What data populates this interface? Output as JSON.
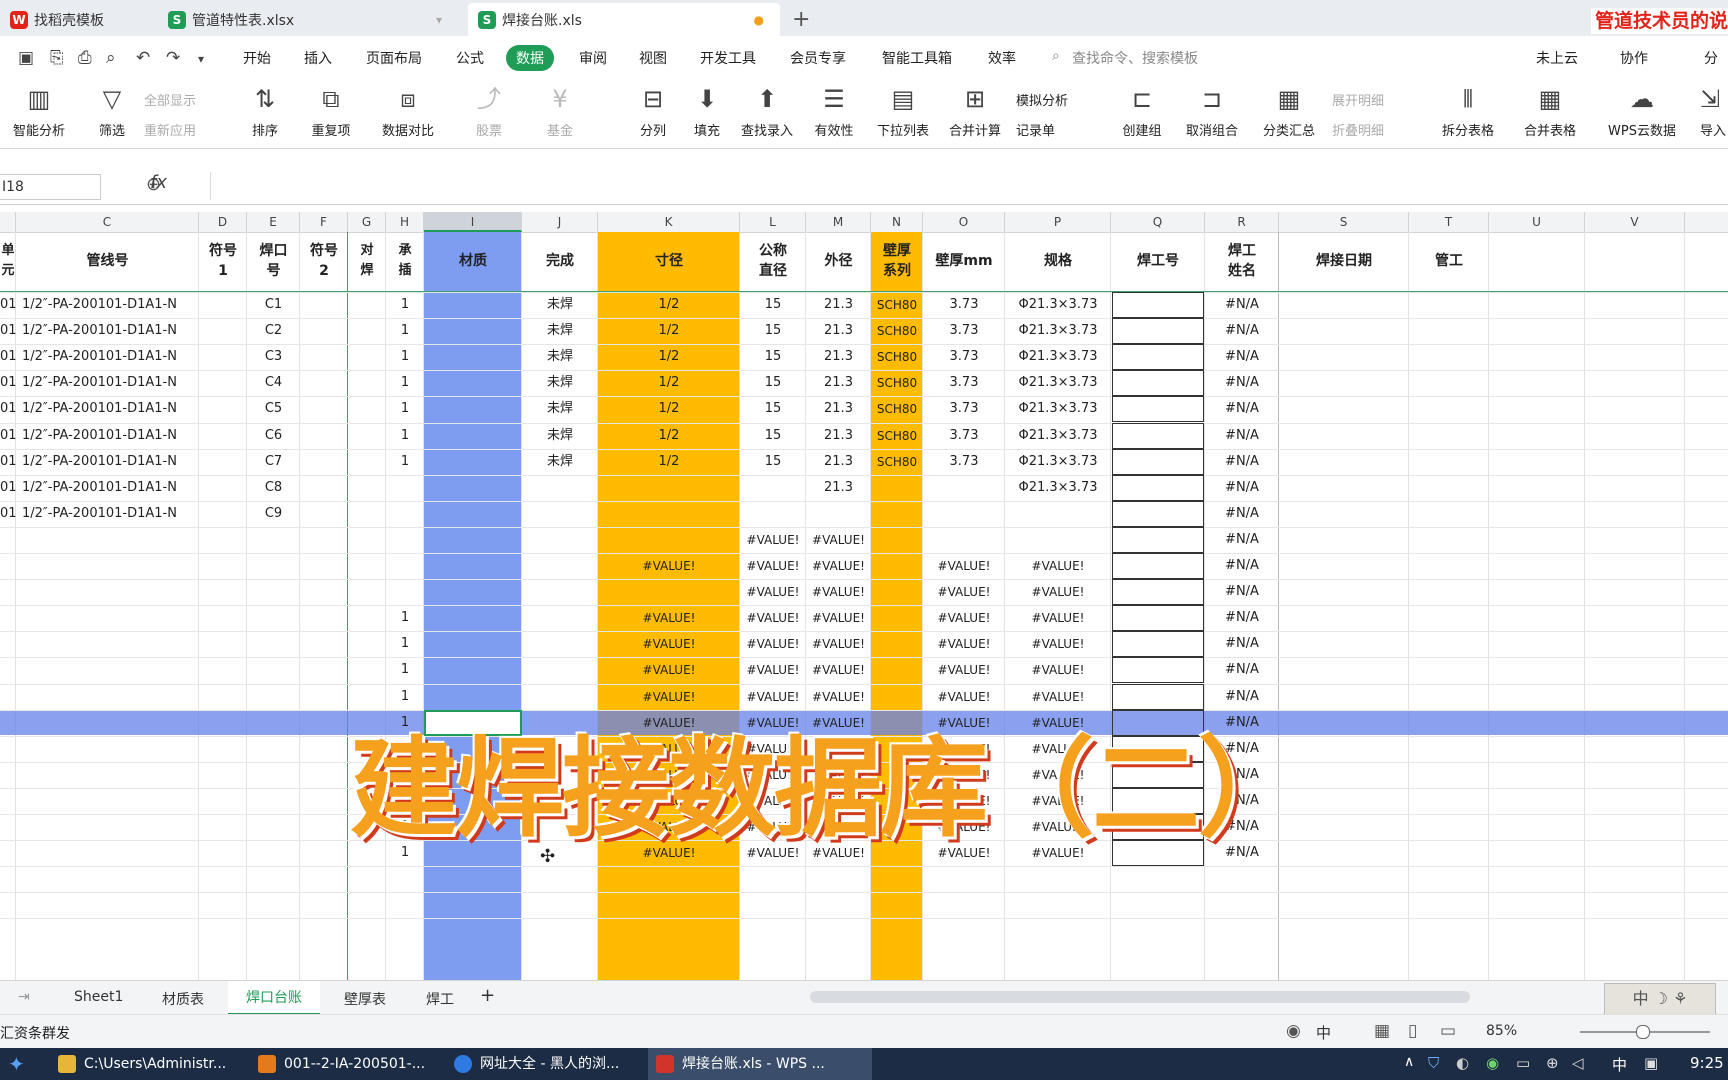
{
  "file_tabs": [
    {
      "label": "找稻壳模板",
      "icon": "wps-logo-icon",
      "color": "#e2231a"
    },
    {
      "label": "管道特性表.xlsx",
      "icon": "spreadsheet-icon",
      "color": "#1f9d57"
    },
    {
      "label": "焊接台账.xls",
      "icon": "spreadsheet-icon",
      "color": "#1f9d57"
    }
  ],
  "banner": "管道技术员的说",
  "menu": [
    "开始",
    "插入",
    "页面布局",
    "公式",
    "数据",
    "审阅",
    "视图",
    "开发工具",
    "会员专享",
    "智能工具箱",
    "效率"
  ],
  "search_placeholder": "查找命令、搜索模板",
  "right_menu": {
    "cloud": "未上云",
    "collab": "协作",
    "share": "分"
  },
  "ribbon": {
    "smart": "智能分析",
    "filter": "筛选",
    "showall": "全部显示",
    "reapply": "重新应用",
    "sort": "排序",
    "dup": "重复项",
    "compare": "数据对比",
    "stock": "股票",
    "fund": "基金",
    "split": "分列",
    "fill": "填充",
    "lookup": "查找录入",
    "validity": "有效性",
    "dropdown": "下拉列表",
    "merge_calc": "合并计算",
    "simulate": "模拟分析",
    "record": "记录单",
    "group": "创建组",
    "ungroup": "取消组合",
    "subtotal": "分类汇总",
    "expand": "展开明细",
    "collapse": "折叠明细",
    "split_table": "拆分表格",
    "merge_table": "合并表格",
    "wps_cloud": "WPS云数据",
    "import": "导入"
  },
  "namebox": "I18",
  "fx": "fx",
  "columns": [
    "C",
    "D",
    "E",
    "F",
    "G",
    "H",
    "I",
    "J",
    "K",
    "L",
    "M",
    "N",
    "O",
    "P",
    "Q",
    "R",
    "S",
    "T",
    "U",
    "V"
  ],
  "headers": {
    "B": "单\n元",
    "C": "管线号",
    "D": "符号\n1",
    "E": "焊口\n号",
    "F": "符号\n2",
    "G": "对\n焊",
    "H": "承\n插",
    "I": "材质",
    "J": "完成",
    "K": "寸径",
    "L": "公称\n直径",
    "M": "外径",
    "N": "壁厚\n系列",
    "O": "壁厚mm",
    "P": "规格",
    "Q": "焊工号",
    "R": "焊工\n姓名",
    "S": "焊接日期",
    "T": "管工"
  },
  "rows": [
    {
      "b": "01",
      "c": "1/2″-PA-200101-D1A1-N",
      "e": "C1",
      "h": "1",
      "j": "未焊",
      "k": "1/2",
      "l": "15",
      "m": "21.3",
      "n": "SCH80",
      "o": "3.73",
      "p": "Φ21.3×3.73",
      "r": "#N/A"
    },
    {
      "b": "01",
      "c": "1/2″-PA-200101-D1A1-N",
      "e": "C2",
      "h": "1",
      "j": "未焊",
      "k": "1/2",
      "l": "15",
      "m": "21.3",
      "n": "SCH80",
      "o": "3.73",
      "p": "Φ21.3×3.73",
      "r": "#N/A"
    },
    {
      "b": "01",
      "c": "1/2″-PA-200101-D1A1-N",
      "e": "C3",
      "h": "1",
      "j": "未焊",
      "k": "1/2",
      "l": "15",
      "m": "21.3",
      "n": "SCH80",
      "o": "3.73",
      "p": "Φ21.3×3.73",
      "r": "#N/A"
    },
    {
      "b": "01",
      "c": "1/2″-PA-200101-D1A1-N",
      "e": "C4",
      "h": "1",
      "j": "未焊",
      "k": "1/2",
      "l": "15",
      "m": "21.3",
      "n": "SCH80",
      "o": "3.73",
      "p": "Φ21.3×3.73",
      "r": "#N/A"
    },
    {
      "b": "01",
      "c": "1/2″-PA-200101-D1A1-N",
      "e": "C5",
      "h": "1",
      "j": "未焊",
      "k": "1/2",
      "l": "15",
      "m": "21.3",
      "n": "SCH80",
      "o": "3.73",
      "p": "Φ21.3×3.73",
      "r": "#N/A"
    },
    {
      "b": "01",
      "c": "1/2″-PA-200101-D1A1-N",
      "e": "C6",
      "h": "1",
      "j": "未焊",
      "k": "1/2",
      "l": "15",
      "m": "21.3",
      "n": "SCH80",
      "o": "3.73",
      "p": "Φ21.3×3.73",
      "r": "#N/A"
    },
    {
      "b": "01",
      "c": "1/2″-PA-200101-D1A1-N",
      "e": "C7",
      "h": "1",
      "j": "未焊",
      "k": "1/2",
      "l": "15",
      "m": "21.3",
      "n": "SCH80",
      "o": "3.73",
      "p": "Φ21.3×3.73",
      "r": "#N/A"
    },
    {
      "b": "01",
      "c": "1/2″-PA-200101-D1A1-N",
      "e": "C8",
      "h": "",
      "j": "",
      "k": "",
      "l": "",
      "m": "21.3",
      "n": "",
      "o": "",
      "p": "Φ21.3×3.73",
      "r": "#N/A"
    },
    {
      "b": "01",
      "c": "1/2″-PA-200101-D1A1-N",
      "e": "C9",
      "h": "",
      "j": "",
      "k": "",
      "l": "",
      "m": "",
      "n": "",
      "o": "",
      "p": "",
      "r": "#N/A"
    },
    {
      "b": "",
      "c": "",
      "e": "",
      "h": "",
      "j": "",
      "k": "",
      "l": "#VALUE!",
      "m": "#VALUE!",
      "n": "",
      "o": "",
      "p": "",
      "r": "#N/A"
    },
    {
      "b": "",
      "c": "",
      "e": "",
      "h": "",
      "j": "",
      "k": "#VALUE!",
      "l": "#VALUE!",
      "m": "#VALUE!",
      "n": "",
      "o": "#VALUE!",
      "p": "#VALUE!",
      "r": "#N/A"
    },
    {
      "b": "",
      "c": "",
      "e": "",
      "h": "",
      "j": "",
      "k": "",
      "l": "#VALUE!",
      "m": "#VALUE!",
      "n": "",
      "o": "#VALUE!",
      "p": "#VALUE!",
      "r": "#N/A"
    },
    {
      "b": "",
      "c": "",
      "e": "",
      "h": "1",
      "j": "",
      "k": "#VALUE!",
      "l": "#VALUE!",
      "m": "#VALUE!",
      "n": "",
      "o": "#VALUE!",
      "p": "#VALUE!",
      "r": "#N/A"
    },
    {
      "b": "",
      "c": "",
      "e": "",
      "h": "1",
      "j": "",
      "k": "#VALUE!",
      "l": "#VALUE!",
      "m": "#VALUE!",
      "n": "",
      "o": "#VALUE!",
      "p": "#VALUE!",
      "r": "#N/A"
    },
    {
      "b": "",
      "c": "",
      "e": "",
      "h": "1",
      "j": "",
      "k": "#VALUE!",
      "l": "#VALUE!",
      "m": "#VALUE!",
      "n": "",
      "o": "#VALUE!",
      "p": "#VALUE!",
      "r": "#N/A"
    },
    {
      "b": "",
      "c": "",
      "e": "",
      "h": "1",
      "j": "",
      "k": "#VALUE!",
      "l": "#VALUE!",
      "m": "#VALUE!",
      "n": "",
      "o": "#VALUE!",
      "p": "#VALUE!",
      "r": "#N/A"
    },
    {
      "b": "",
      "c": "",
      "e": "",
      "h": "1",
      "j": "",
      "k": "#VALUE!",
      "l": "#VALUE!",
      "m": "#VALUE!",
      "n": "",
      "o": "#VALUE!",
      "p": "#VALUE!",
      "r": "#N/A"
    },
    {
      "b": "",
      "c": "",
      "e": "",
      "h": "1",
      "j": "",
      "k": "#VALUE!",
      "l": "#VALUE!",
      "m": "#VALUE!",
      "n": "",
      "o": "#VALUE!",
      "p": "#VALUE!",
      "r": "#N/A"
    },
    {
      "b": "",
      "c": "",
      "e": "",
      "h": "1",
      "j": "",
      "k": "#VALUE!",
      "l": "#VALUE!",
      "m": "#VALUE!",
      "n": "",
      "o": "#VALUE!",
      "p": "#VALUE!",
      "r": "#N/A"
    },
    {
      "b": "",
      "c": "",
      "e": "",
      "h": "1",
      "j": "",
      "k": "#VALUE!",
      "l": "#VALUE!",
      "m": "#VALUE!",
      "n": "",
      "o": "#VALUE!",
      "p": "#VALUE!",
      "r": "#N/A"
    },
    {
      "b": "",
      "c": "",
      "e": "",
      "h": "1",
      "j": "",
      "k": "#VALUE!",
      "l": "#VALUE!",
      "m": "#VALUE!",
      "n": "",
      "o": "#VALUE!",
      "p": "#VALUE!",
      "r": "#N/A"
    },
    {
      "b": "",
      "c": "",
      "e": "",
      "h": "1",
      "j": "",
      "k": "#VALUE!",
      "l": "#VALUE!",
      "m": "#VALUE!",
      "n": "",
      "o": "#VALUE!",
      "p": "#VALUE!",
      "r": "#N/A"
    }
  ],
  "overlay_title": "建焊接数据库（二）",
  "sheets": [
    "Sheet1",
    "材质表",
    "焊口台账",
    "壁厚表",
    "焊工"
  ],
  "status_left": "汇资条群发",
  "zoom": "85%",
  "ime": "中",
  "taskbar": [
    {
      "label": "C:\\Users\\Administr...",
      "color": "#e8b53a"
    },
    {
      "label": "001--2-IA-200501-...",
      "color": "#e37b1c"
    },
    {
      "label": "网址大全 - 黑人的浏...",
      "color": "#2d7be0"
    },
    {
      "label": "焊接台账.xls - WPS ...",
      "color": "#d2342a"
    }
  ],
  "tray_ime": "中",
  "clock": "9:25"
}
